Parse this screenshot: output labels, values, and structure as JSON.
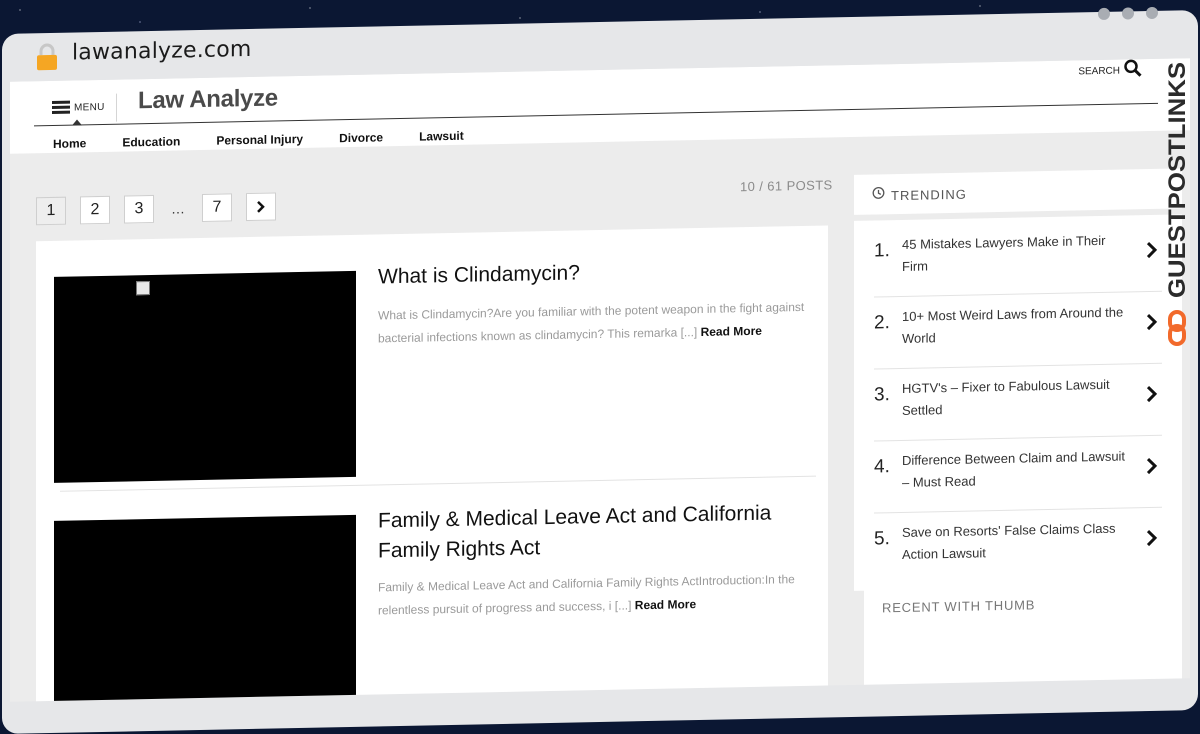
{
  "browser": {
    "url": "lawanalyze.com"
  },
  "header": {
    "menu_label": "MENU",
    "logo": "Law Analyze",
    "search_label": "SEARCH"
  },
  "nav": {
    "items": [
      "Home",
      "Education",
      "Personal Injury",
      "Divorce",
      "Lawsuit"
    ]
  },
  "pagination": {
    "pages": [
      "1",
      "2",
      "3",
      "7"
    ],
    "ellipsis": "…",
    "current": "1",
    "posts_count": "10 / 61 POSTS"
  },
  "posts": [
    {
      "title": "What is Clindamycin?",
      "excerpt": "What is Clindamycin?Are you familiar with the potent weapon in the fight against bacterial infections known as clindamycin? This remarka [...]",
      "read_more": "Read More"
    },
    {
      "title": "Family & Medical Leave Act and California Family Rights Act",
      "excerpt": "Family & Medical Leave Act and California Family Rights ActIntroduction:In the relentless pursuit of progress and success, i [...]",
      "read_more": "Read More"
    }
  ],
  "sidebar": {
    "trending_title": "TRENDING",
    "trending": [
      {
        "num": "1.",
        "text": "45 Mistakes Lawyers Make in Their Firm"
      },
      {
        "num": "2.",
        "text": "10+ Most Weird Laws from Around the World"
      },
      {
        "num": "3.",
        "text": "HGTV's – Fixer to Fabulous Lawsuit Settled"
      },
      {
        "num": "4.",
        "text": "Difference Between Claim and Lawsuit – Must Read"
      },
      {
        "num": "5.",
        "text": "Save on Resorts' False Claims Class Action Lawsuit"
      }
    ],
    "recent_title": "RECENT WITH THUMB"
  },
  "watermark": {
    "text": "GUESTPOSTLINKS"
  },
  "colors": {
    "background": "#0b1733",
    "frame": "#e6e7e9",
    "lock": "#f5a623",
    "watermark_dark": "#2b2b2b",
    "watermark_accent": "#f26a2b"
  }
}
